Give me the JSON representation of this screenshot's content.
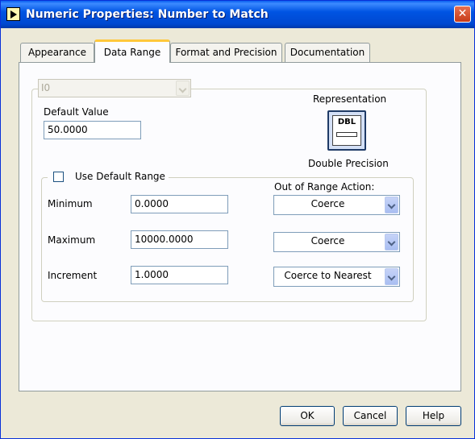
{
  "window": {
    "title": "Numeric Properties: Number to Match",
    "close_glyph": "✕"
  },
  "tabs": [
    {
      "label": "Appearance"
    },
    {
      "label": "Data Range"
    },
    {
      "label": "Format and Precision"
    },
    {
      "label": "Documentation"
    }
  ],
  "active_tab": "Data Range",
  "data_type_select": {
    "value": "I0"
  },
  "default_value": {
    "label": "Default Value",
    "value": "50.0000"
  },
  "representation": {
    "label": "Representation",
    "icon_text": "DBL",
    "type_label": "Double Precision"
  },
  "range": {
    "use_default_label": "Use Default Range",
    "use_default_checked": false,
    "out_of_range_header": "Out of Range Action:",
    "rows": [
      {
        "label": "Minimum",
        "value": "0.0000",
        "action": "Coerce"
      },
      {
        "label": "Maximum",
        "value": "10000.0000",
        "action": "Coerce"
      },
      {
        "label": "Increment",
        "value": "1.0000",
        "action": "Coerce to Nearest"
      }
    ]
  },
  "buttons": {
    "ok": "OK",
    "cancel": "Cancel",
    "help": "Help"
  }
}
